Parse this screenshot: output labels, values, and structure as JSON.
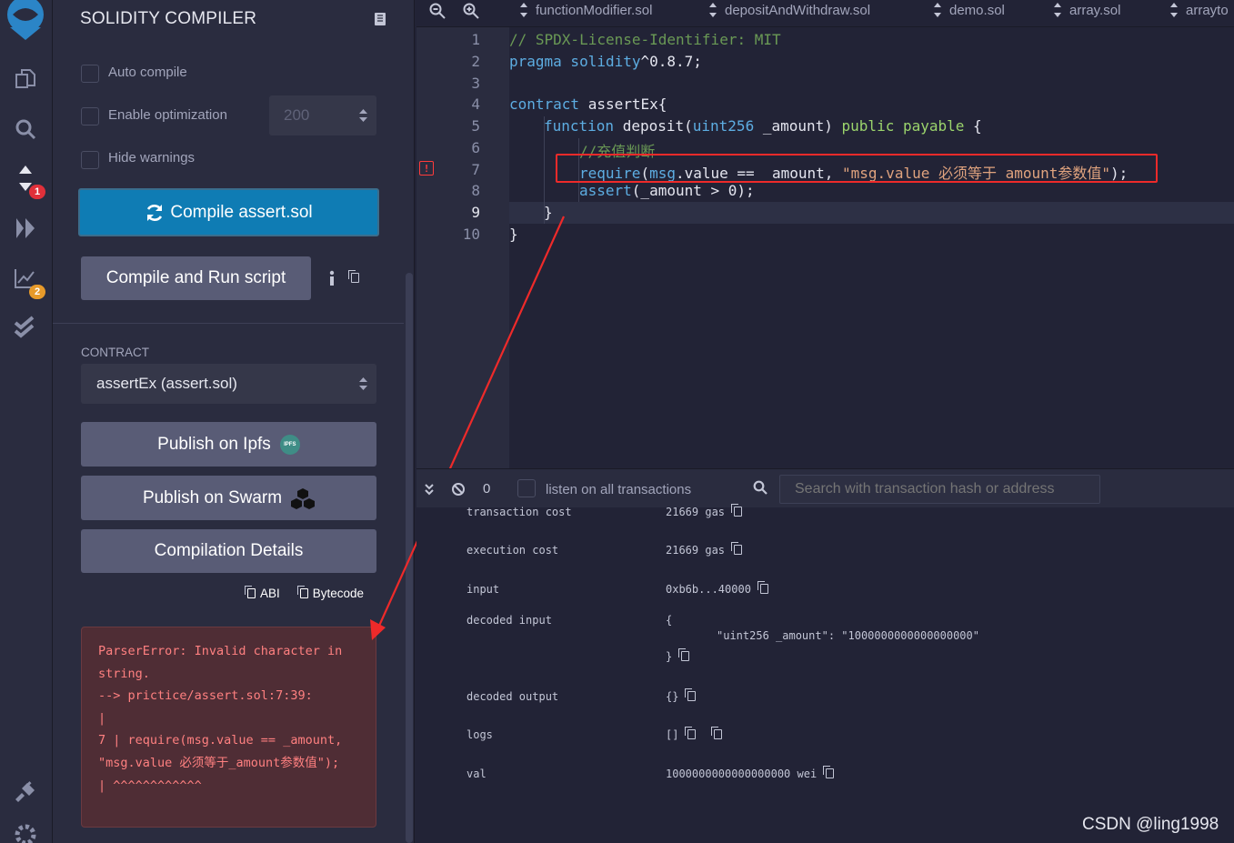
{
  "sidebar": {
    "badges": {
      "compiler": "1",
      "analysis": "2"
    }
  },
  "panel": {
    "title": "SOLIDITY COMPILER",
    "auto_compile": "Auto compile",
    "enable_optimization": "Enable optimization",
    "runs_value": "200",
    "hide_warnings": "Hide warnings",
    "compile_button": "Compile assert.sol",
    "compile_run_button": "Compile and Run script",
    "contract_label": "CONTRACT",
    "contract_selected": "assertEx (assert.sol)",
    "publish_ipfs": "Publish on Ipfs",
    "ipfs_logo_text": "IPFS",
    "publish_swarm": "Publish on Swarm",
    "compilation_details": "Compilation Details",
    "abi": "ABI",
    "bytecode": "Bytecode",
    "error_lines": [
      "ParserError: Invalid character in",
      "string.",
      "--> prictice/assert.sol:7:39:",
      "|",
      "7 | require(msg.value == _amount,",
      "\"msg.value 必须等于_amount参数值\");",
      "| ^^^^^^^^^^^^"
    ]
  },
  "tabs": [
    "functionModifier.sol",
    "depositAndWithdraw.sol",
    "demo.sol",
    "array.sol",
    "arrayto"
  ],
  "editor": {
    "line_numbers": [
      "1",
      "2",
      "3",
      "4",
      "5",
      "6",
      "7",
      "8",
      "9",
      "10"
    ],
    "l1": "// SPDX-License-Identifier: MIT",
    "l2a": "pragma solidity",
    "l2b": "^0.8.7;",
    "l4a": "contract",
    "l4b": " assertEx{",
    "l5a": "function",
    "l5b": " deposit(",
    "l5c": "uint256",
    "l5d": " _amount) ",
    "l5e": "public payable",
    "l5f": " {",
    "l6": "//充值判断",
    "l7a": "require",
    "l7b": "(",
    "l7c": "msg",
    "l7d": ".value == _amount, ",
    "l7e": "\"msg.value 必须等于_amount参数值\"",
    "l7f": ");",
    "l8a": "assert",
    "l8b": "(_amount > ",
    "l8c": "0",
    "l8d": ");",
    "l9": "}",
    "l10": "}"
  },
  "terminal": {
    "count": "0",
    "listen_label": "listen on all transactions",
    "search_placeholder": "Search with transaction hash or address",
    "rows": {
      "transaction_cost": {
        "label": "transaction cost",
        "value": "21669 gas"
      },
      "execution_cost": {
        "label": "execution cost",
        "value": "21669 gas"
      },
      "input": {
        "label": "input",
        "value": "0xb6b...40000"
      },
      "decoded_input": {
        "label": "decoded input",
        "open": "{",
        "entry": "\"uint256 _amount\": \"1000000000000000000\"",
        "close": "}"
      },
      "decoded_output": {
        "label": "decoded output",
        "value": "{}"
      },
      "logs": {
        "label": "logs",
        "value": "[]"
      },
      "val": {
        "label": "val",
        "value": "1000000000000000000 wei"
      }
    }
  },
  "watermark": "CSDN @ling1998",
  "colors": {
    "accent": "#0f7cb4",
    "error_red": "#ff3b3b",
    "annotation_red": "#ee2a2a"
  }
}
